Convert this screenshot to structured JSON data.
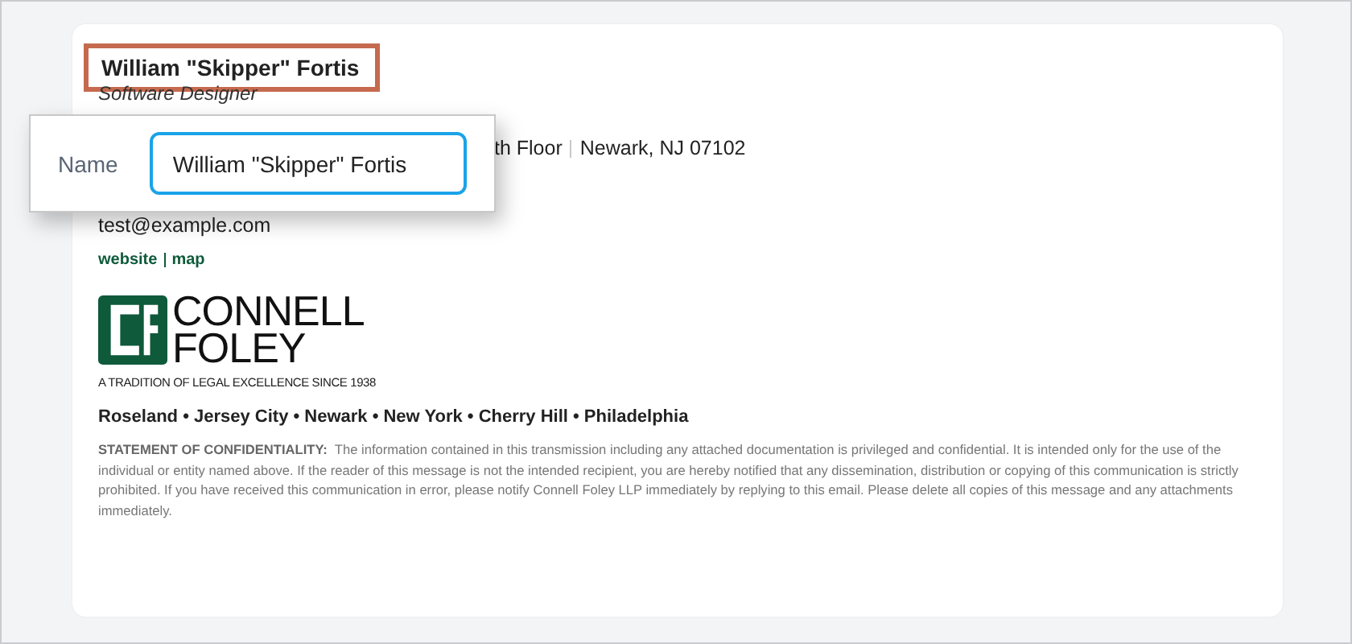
{
  "signature": {
    "name": "William \"Skipper\" Fortis",
    "title": "Software Designer",
    "address": [
      "th Floor",
      "Newark, NJ 07102"
    ],
    "email": "test@example.com",
    "links": [
      {
        "label": "website"
      },
      {
        "label": "map"
      }
    ],
    "logo": {
      "line_1": "CONNELL",
      "line_2": "FOLEY",
      "tagline": "A TRADITION OF LEGAL EXCELLENCE SINCE 1938"
    },
    "offices": "Roseland • Jersey City • Newark • New York • Cherry Hill • Philadelphia",
    "confidentiality": {
      "heading": "STATEMENT OF CONFIDENTIALITY:",
      "text": "The information contained in this transmission including any attached documentation is privileged and confidential. It is intended only for the use of the individual or entity named above. If the reader of this message is not the intended recipient, you are hereby notified that any dissemination, distribution or copying of this communication is strictly prohibited. If you have received this communication in error, please notify Connell Foley LLP immediately by replying to this email. Please delete all copies of this message and any attachments immediately."
    }
  },
  "popup": {
    "label": "Name",
    "value": "William \"Skipper\" Fortis"
  }
}
